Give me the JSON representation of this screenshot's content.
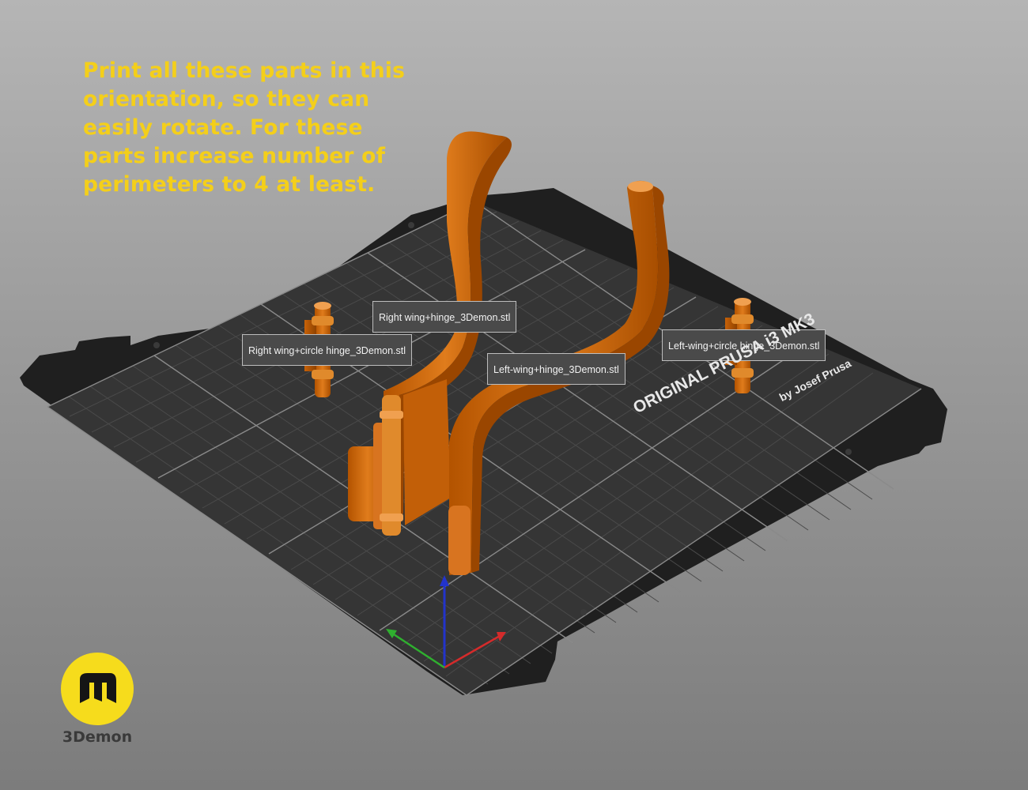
{
  "instruction_lines": [
    "Print all these parts in this",
    "orientation, so they can",
    "easily rotate. For these",
    "parts increase number of",
    "perimeters to 4 at least."
  ],
  "object_labels": {
    "right_wing_circle_hinge": "Right wing+circle hinge_3Demon.stl",
    "right_wing_hinge": "Right wing+hinge_3Demon.stl",
    "left_wing_hinge": "Left-wing+hinge_3Demon.stl",
    "left_wing_circle_hinge": "Left-wing+circle hinge_3Demon.stl"
  },
  "bed": {
    "brand": "ORIGINAL PRUSA i3 MK3",
    "subtitle": "by Josef Prusa"
  },
  "logo": {
    "glyph": "m",
    "name": "3Demon"
  },
  "colors": {
    "instruction_text": "#f4cf1a",
    "part_orange": "#d2680a",
    "bed_surface": "#2f2f2f",
    "logo_yellow": "#f6dc1c",
    "axis_x": "#d42b2b",
    "axis_y": "#2fb02f",
    "axis_z": "#2233cc"
  }
}
